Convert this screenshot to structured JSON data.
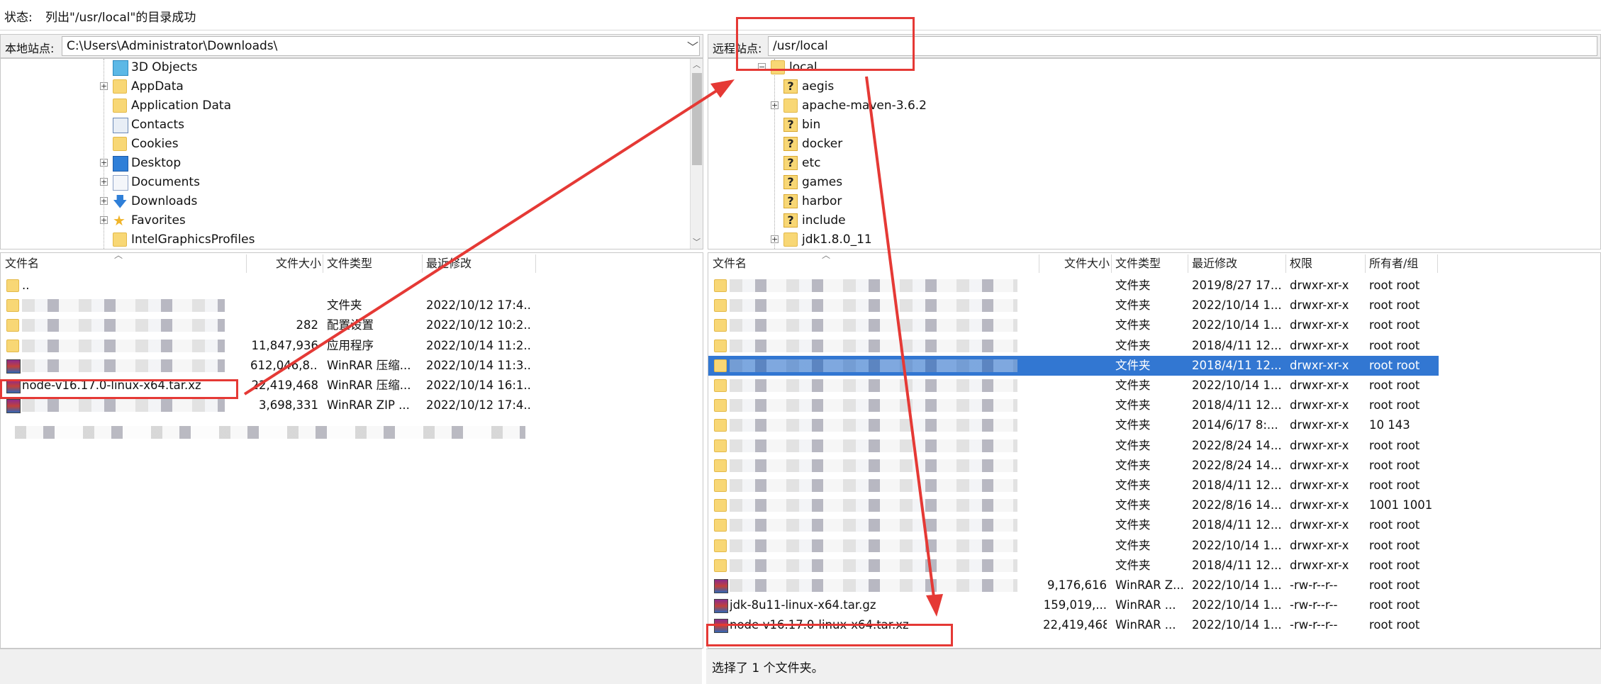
{
  "status": {
    "label": "状态:",
    "text": "列出\"/usr/local\"的目录成功"
  },
  "local": {
    "site_label": "本地站点:",
    "path": "C:\\Users\\Administrator\\Downloads\\",
    "tree": [
      {
        "label": "3D Objects",
        "icon": "3d-objects-icon",
        "expandable": false
      },
      {
        "label": "AppData",
        "icon": "folder-icon",
        "expandable": true
      },
      {
        "label": "Application Data",
        "icon": "folder-icon",
        "expandable": false
      },
      {
        "label": "Contacts",
        "icon": "contacts-icon",
        "expandable": false
      },
      {
        "label": "Cookies",
        "icon": "folder-icon",
        "expandable": false
      },
      {
        "label": "Desktop",
        "icon": "desktop-icon",
        "expandable": true
      },
      {
        "label": "Documents",
        "icon": "documents-icon",
        "expandable": true
      },
      {
        "label": "Downloads",
        "icon": "downloads-icon",
        "expandable": true
      },
      {
        "label": "Favorites",
        "icon": "star-icon",
        "expandable": true
      },
      {
        "label": "IntelGraphicsProfiles",
        "icon": "folder-icon",
        "expandable": false
      }
    ],
    "columns": [
      "文件名",
      "文件大小",
      "文件类型",
      "最近修改"
    ],
    "rows": [
      {
        "name": "..",
        "size": "",
        "type": "",
        "modified": ""
      },
      {
        "name": "",
        "size": "",
        "type": "文件夹",
        "modified": "2022/10/12 17:4..."
      },
      {
        "name": "",
        "size": "282",
        "type": "配置设置",
        "modified": "2022/10/12 10:2..."
      },
      {
        "name": "",
        "size": "11,847,936",
        "type": "应用程序",
        "modified": "2022/10/14 11:2..."
      },
      {
        "name": "",
        "size": "612,046,8...",
        "type": "WinRAR 压缩...",
        "modified": "2022/10/14 11:3..."
      },
      {
        "name": "node-v16.17.0-linux-x64.tar.xz",
        "size": "22,419,468",
        "type": "WinRAR 压缩...",
        "modified": "2022/10/14 16:1..."
      },
      {
        "name": "",
        "size": "3,698,331",
        "type": "WinRAR ZIP ...",
        "modified": "2022/10/12 17:4..."
      }
    ]
  },
  "remote": {
    "site_label": "远程站点:",
    "path": "/usr/local",
    "tree": [
      {
        "label": "local",
        "icon": "folder-open-icon",
        "expandable": true
      },
      {
        "label": "aegis",
        "icon": "unknown-folder-icon",
        "expandable": false
      },
      {
        "label": "apache-maven-3.6.2",
        "icon": "folder-icon",
        "expandable": true
      },
      {
        "label": "bin",
        "icon": "unknown-folder-icon",
        "expandable": false
      },
      {
        "label": "docker",
        "icon": "unknown-folder-icon",
        "expandable": false
      },
      {
        "label": "etc",
        "icon": "unknown-folder-icon",
        "expandable": false
      },
      {
        "label": "games",
        "icon": "unknown-folder-icon",
        "expandable": false
      },
      {
        "label": "harbor",
        "icon": "unknown-folder-icon",
        "expandable": false
      },
      {
        "label": "include",
        "icon": "unknown-folder-icon",
        "expandable": false
      },
      {
        "label": "jdk1.8.0_11",
        "icon": "folder-icon",
        "expandable": true
      }
    ],
    "columns": [
      "文件名",
      "文件大小",
      "文件类型",
      "最近修改",
      "权限",
      "所有者/组"
    ],
    "rows": [
      {
        "name": "",
        "size": "",
        "type": "文件夹",
        "modified": "2019/8/27 17...",
        "perm": "drwxr-xr-x",
        "owner": "root root"
      },
      {
        "name": "",
        "size": "",
        "type": "文件夹",
        "modified": "2022/10/14 1...",
        "perm": "drwxr-xr-x",
        "owner": "root root"
      },
      {
        "name": "",
        "size": "",
        "type": "文件夹",
        "modified": "2022/10/14 1...",
        "perm": "drwxr-xr-x",
        "owner": "root root"
      },
      {
        "name": "",
        "size": "",
        "type": "文件夹",
        "modified": "2018/4/11 12...",
        "perm": "drwxr-xr-x",
        "owner": "root root"
      },
      {
        "name": "",
        "size": "",
        "type": "文件夹",
        "modified": "2018/4/11 12...",
        "perm": "drwxr-xr-x",
        "owner": "root root",
        "selected": true
      },
      {
        "name": "",
        "size": "",
        "type": "文件夹",
        "modified": "2022/10/14 1...",
        "perm": "drwxr-xr-x",
        "owner": "root root"
      },
      {
        "name": "",
        "size": "",
        "type": "文件夹",
        "modified": "2018/4/11 12...",
        "perm": "drwxr-xr-x",
        "owner": "root root"
      },
      {
        "name": "",
        "size": "",
        "type": "文件夹",
        "modified": "2014/6/17 8:...",
        "perm": "drwxr-xr-x",
        "owner": "10 143"
      },
      {
        "name": "",
        "size": "",
        "type": "文件夹",
        "modified": "2022/8/24 14...",
        "perm": "drwxr-xr-x",
        "owner": "root root"
      },
      {
        "name": "",
        "size": "",
        "type": "文件夹",
        "modified": "2022/8/24 14...",
        "perm": "drwxr-xr-x",
        "owner": "root root"
      },
      {
        "name": "",
        "size": "",
        "type": "文件夹",
        "modified": "2018/4/11 12...",
        "perm": "drwxr-xr-x",
        "owner": "root root"
      },
      {
        "name": "",
        "size": "",
        "type": "文件夹",
        "modified": "2022/8/16 14...",
        "perm": "drwxr-xr-x",
        "owner": "1001 1001"
      },
      {
        "name": "",
        "size": "",
        "type": "文件夹",
        "modified": "2018/4/11 12...",
        "perm": "drwxr-xr-x",
        "owner": "root root"
      },
      {
        "name": "",
        "size": "",
        "type": "文件夹",
        "modified": "2022/10/14 1...",
        "perm": "drwxr-xr-x",
        "owner": "root root"
      },
      {
        "name": "",
        "size": "",
        "type": "文件夹",
        "modified": "2018/4/11 12...",
        "perm": "drwxr-xr-x",
        "owner": "root root"
      },
      {
        "name": "",
        "size": "9,176,616",
        "type": "WinRAR Z...",
        "modified": "2022/10/14 1...",
        "perm": "-rw-r--r--",
        "owner": "root root"
      },
      {
        "name": "jdk-8u11-linux-x64.tar.gz",
        "size": "159,019,...",
        "type": "WinRAR ...",
        "modified": "2022/10/14 1...",
        "perm": "-rw-r--r--",
        "owner": "root root"
      },
      {
        "name": "node-v16.17.0-linux-x64.tar.xz",
        "size": "22,419,468",
        "type": "WinRAR ...",
        "modified": "2022/10/14 1...",
        "perm": "-rw-r--r--",
        "owner": "root root"
      }
    ],
    "footer": "选择了 1 个文件夹。"
  },
  "colors": {
    "selection": "#3277d2",
    "annotation": "#e53935",
    "folder": "#f8d775"
  }
}
